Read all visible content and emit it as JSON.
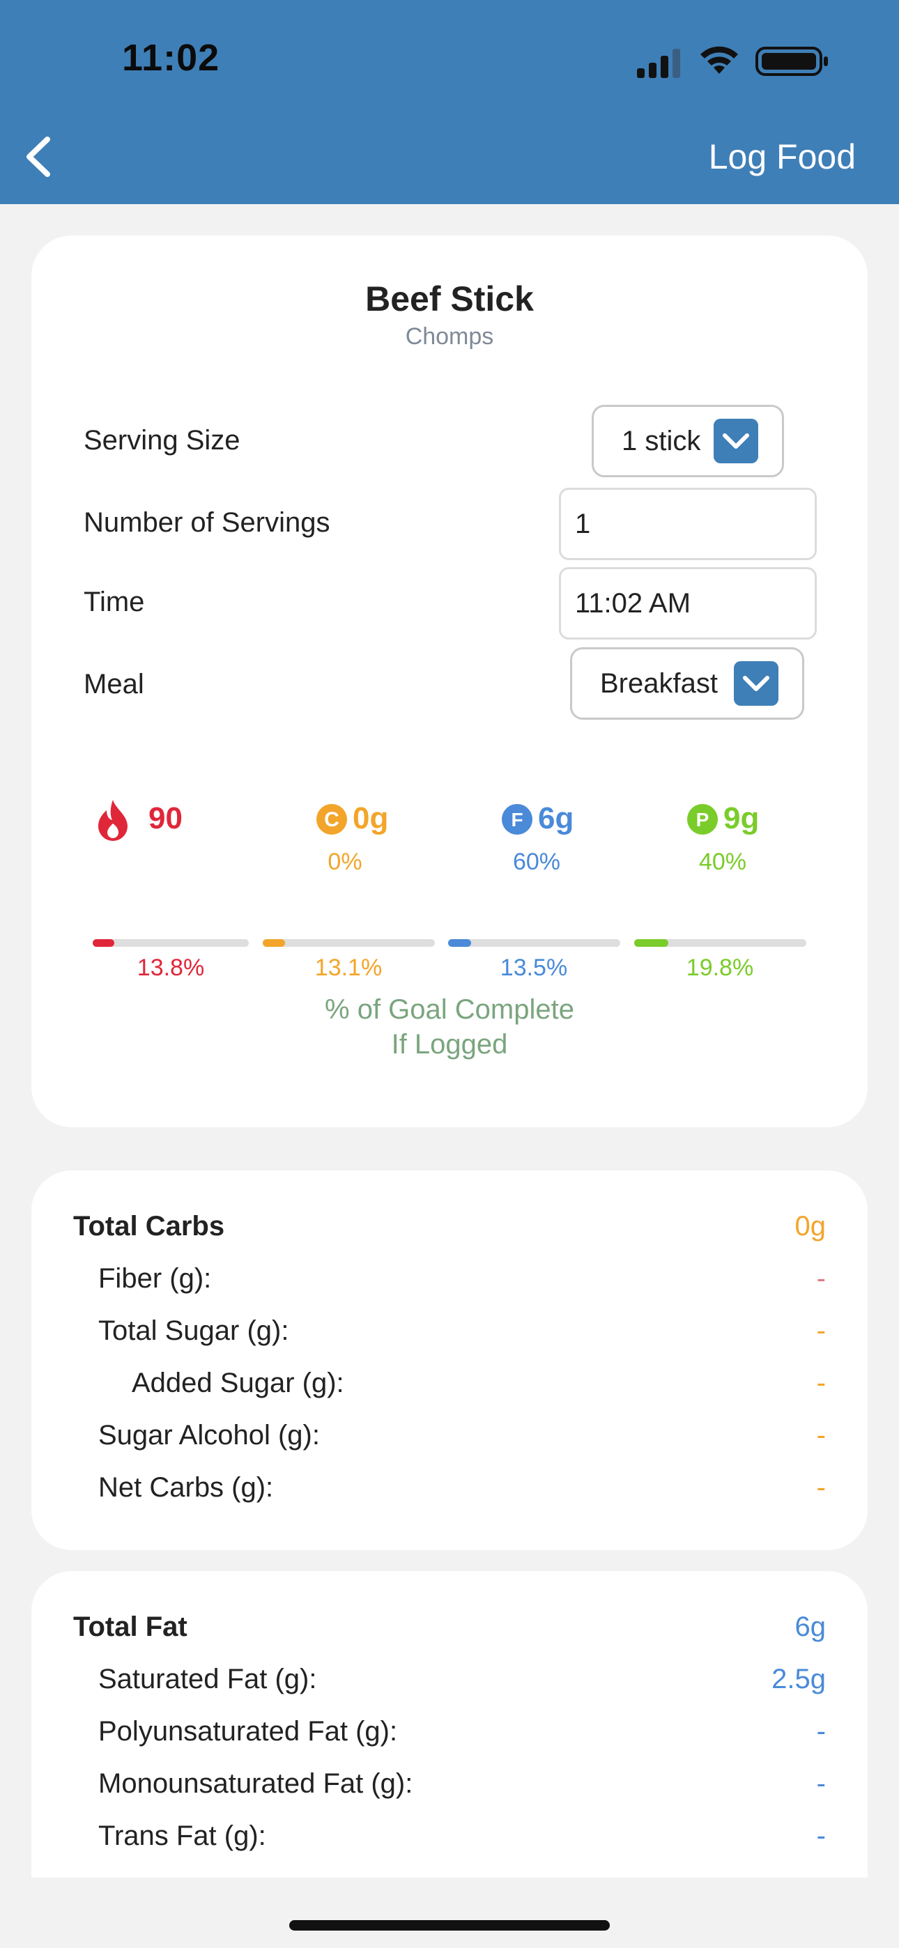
{
  "status_bar": {
    "time": "11:02"
  },
  "header": {
    "title": "Log Food"
  },
  "food": {
    "name": "Beef Stick",
    "brand": "Chomps"
  },
  "form": {
    "serving_size_label": "Serving Size",
    "serving_size_value": "1 stick",
    "servings_label": "Number of Servings",
    "servings_value": "1",
    "time_label": "Time",
    "time_value": "11:02 AM",
    "meal_label": "Meal",
    "meal_value": "Breakfast"
  },
  "macros": {
    "calories": "90",
    "carbs": {
      "value": "0g",
      "pct": "0%",
      "letter": "C"
    },
    "fat": {
      "value": "6g",
      "pct": "60%",
      "letter": "F"
    },
    "protein": {
      "value": "9g",
      "pct": "40%",
      "letter": "P"
    }
  },
  "goals": {
    "bars": [
      {
        "name": "calories",
        "label": "13.8%",
        "fraction": 0.138,
        "color": "#e0273a"
      },
      {
        "name": "carbs",
        "label": "13.1%",
        "fraction": 0.131,
        "color": "#f2a52a"
      },
      {
        "name": "fat",
        "label": "13.5%",
        "fraction": 0.135,
        "color": "#4a8ad8"
      },
      {
        "name": "protein",
        "label": "19.8%",
        "fraction": 0.198,
        "color": "#7acc2a"
      }
    ],
    "note_line1": "% of Goal Complete",
    "note_line2": "If Logged"
  },
  "carbs_section": {
    "title": "Total Carbs",
    "total": "0g",
    "rows": [
      {
        "label": "Fiber (g):",
        "value": "-"
      },
      {
        "label": "Total Sugar (g):",
        "value": "-"
      },
      {
        "label": "Added Sugar (g):",
        "value": "-"
      },
      {
        "label": "Sugar Alcohol (g):",
        "value": "-"
      },
      {
        "label": "Net Carbs (g):",
        "value": "-"
      }
    ]
  },
  "fat_section": {
    "title": "Total Fat",
    "total": "6g",
    "rows": [
      {
        "label": "Saturated Fat (g):",
        "value": "2.5g"
      },
      {
        "label": "Polyunsaturated Fat (g):",
        "value": "-"
      },
      {
        "label": "Monounsaturated Fat (g):",
        "value": "-"
      },
      {
        "label": "Trans Fat (g):",
        "value": "-"
      }
    ]
  },
  "colors": {
    "header_bg": "#3f7fb7",
    "calories": "#e0273a",
    "carbs": "#f2a52a",
    "fat": "#4a8ad8",
    "protein": "#7acc2a",
    "goal_note": "#7aa57e"
  }
}
